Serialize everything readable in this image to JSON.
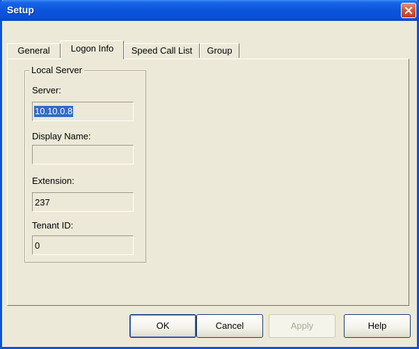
{
  "window": {
    "title": "Setup",
    "close_label": "Close"
  },
  "tabs": [
    {
      "label": "General",
      "active": false
    },
    {
      "label": "Logon Info",
      "active": true
    },
    {
      "label": "Speed Call List",
      "active": false
    },
    {
      "label": "Group",
      "active": false
    }
  ],
  "local_server": {
    "group_title": "Local Server",
    "server_label": "Server:",
    "server_value": "10.10.0.8",
    "display_name_label": "Display Name:",
    "display_name_value": "",
    "extension_label": "Extension:",
    "extension_value": "237",
    "tenant_id_label": "Tenant ID:",
    "tenant_id_value": "0"
  },
  "buttons": {
    "ok": "OK",
    "cancel": "Cancel",
    "apply": "Apply",
    "help": "Help"
  },
  "colors": {
    "titlebar": "#0a55dd",
    "close_button": "#d9553a",
    "selection": "#316ac5",
    "dialog_background": "#ece9d8"
  }
}
